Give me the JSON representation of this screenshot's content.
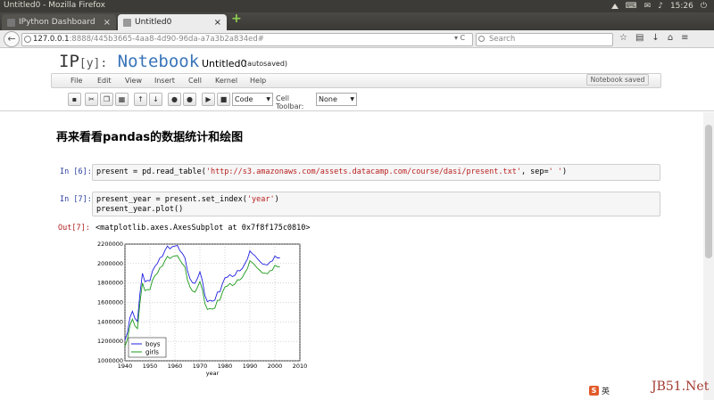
{
  "os": {
    "window_title": "Untitled0 - Mozilla Firefox",
    "time": "15:26"
  },
  "browser": {
    "tabs": [
      {
        "label": "IPython Dashboard"
      },
      {
        "label": "Untitled0"
      }
    ],
    "url_host": "127.0.0.1",
    "url_rest": ":8888/445b3665-4aa8-4d90-96da-a7a3b2a834ed#",
    "search_placeholder": "Search"
  },
  "notebook": {
    "logo_prefix": "IP",
    "logo_bracket": "[y]:",
    "logo_word": "Notebook",
    "name": "Untitled0",
    "status": "(autosaved)",
    "saved_badge": "Notebook saved",
    "menu": [
      "File",
      "Edit",
      "View",
      "Insert",
      "Cell",
      "Kernel",
      "Help"
    ],
    "toolbar": {
      "cell_type": "Code",
      "cell_toolbar_label": "Cell Toolbar:",
      "cell_toolbar_value": "None"
    }
  },
  "cells": {
    "heading": "再来看看pandas的数据统计和绘图",
    "in6_prompt": "In [6]:",
    "in6_code_pre": "present = pd.read_table(",
    "in6_code_str1": "'http://s3.amazonaws.com/assets.datacamp.com/course/dasi/present.txt'",
    "in6_code_mid": ", sep=",
    "in6_code_str2": "' '",
    "in6_code_post": ")",
    "in7_prompt": "In [7]:",
    "in7_line1_pre": "present_year = present.set_index(",
    "in7_line1_str": "'year'",
    "in7_line1_post": ")",
    "in7_line2": "present_year.plot()",
    "out7_prompt": "Out[7]:",
    "out7_text": "<matplotlib.axes.AxesSubplot at 0x7f8f175c0810>"
  },
  "chart_data": {
    "type": "line",
    "xlabel": "year",
    "ylabel": "",
    "xlim": [
      1940,
      2010
    ],
    "ylim": [
      1000000,
      2200000
    ],
    "xticks": [
      "1940",
      "1950",
      "1960",
      "1970",
      "1980",
      "1990",
      "2000",
      "2010"
    ],
    "yticks": [
      "1000000",
      "1200000",
      "1400000",
      "1600000",
      "1800000",
      "2000000",
      "2200000"
    ],
    "grid": true,
    "legend_position": "lower-left",
    "colors": {
      "boys": "#2020e0",
      "girls": "#1a9a1a"
    },
    "x": [
      1940,
      1941,
      1942,
      1943,
      1944,
      1945,
      1946,
      1947,
      1948,
      1949,
      1950,
      1951,
      1952,
      1953,
      1954,
      1955,
      1956,
      1957,
      1958,
      1959,
      1960,
      1961,
      1962,
      1963,
      1964,
      1965,
      1966,
      1967,
      1968,
      1969,
      1970,
      1971,
      1972,
      1973,
      1974,
      1975,
      1976,
      1977,
      1978,
      1979,
      1980,
      1981,
      1982,
      1983,
      1984,
      1985,
      1986,
      1987,
      1988,
      1989,
      1990,
      1991,
      1992,
      1993,
      1994,
      1995,
      1996,
      1997,
      1998,
      1999,
      2000,
      2001,
      2002
    ],
    "series": [
      {
        "name": "boys",
        "values": [
          1211684,
          1289734,
          1444365,
          1508959,
          1435301,
          1404587,
          1691220,
          1899876,
          1813852,
          1826352,
          1823555,
          1923020,
          1971262,
          2001798,
          2059068,
          2073719,
          2133588,
          2179960,
          2152546,
          2173638,
          2179708,
          2186274,
          2132466,
          2101632,
          2060162,
          1927054,
          1845862,
          1803388,
          1796326,
          1846572,
          1915378,
          1822910,
          1669927,
          1608326,
          1622114,
          1613135,
          1624436,
          1705916,
          1709394,
          1791267,
          1852616,
          1860272,
          1885676,
          1865553,
          1879490,
          1927983,
          1924868,
          1951153,
          1999462,
          2043983,
          2129495,
          2101518,
          2082097,
          2048861,
          2022589,
          1996355,
          1990480,
          1985596,
          2016205,
          2026854,
          2076969,
          2057922,
          2057979
        ]
      },
      {
        "name": "girls",
        "values": [
          1148715,
          1223693,
          1364631,
          1427901,
          1359499,
          1330869,
          1597452,
          1800064,
          1721216,
          1733177,
          1730594,
          1827830,
          1875724,
          1900322,
          1958294,
          1973576,
          2029502,
          2074824,
          2051266,
          2071158,
          2078142,
          2082052,
          2034896,
          1996388,
          1967328,
          1833304,
          1760412,
          1717571,
          1705238,
          1753634,
          1816008,
          1733060,
          1588484,
          1528639,
          1537844,
          1531063,
          1543352,
          1620716,
          1623885,
          1703131,
          1759642,
          1768966,
          1794861,
          1773380,
          1789651,
          1832578,
          1831679,
          1858241,
          1907086,
          1946825,
          2028717,
          2009389,
          1982917,
          1951379,
          1930178,
          1903234,
          1901014,
          1895298,
          1925348,
          1932563,
          1981845,
          1968011,
          1963747
        ]
      }
    ]
  },
  "ime": {
    "logo": "S",
    "text": "英"
  },
  "watermark": "JB51.Net"
}
